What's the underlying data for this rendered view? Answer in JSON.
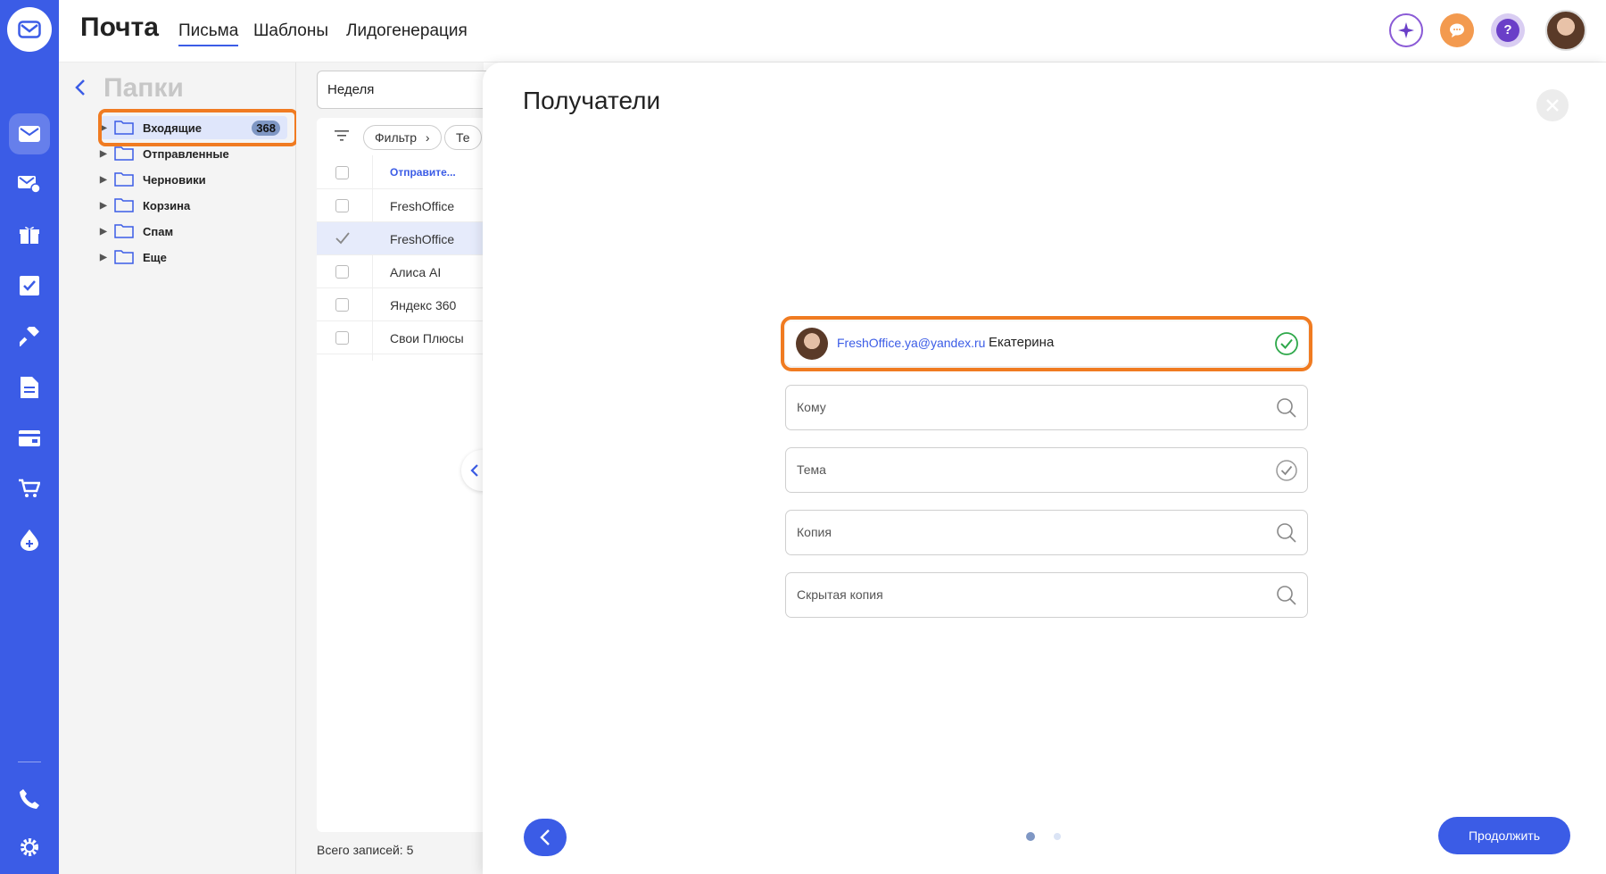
{
  "header": {
    "app_title": "Почта",
    "tabs": [
      {
        "label": "Письма",
        "active": true
      },
      {
        "label": "Шаблоны",
        "active": false
      },
      {
        "label": "Лидогенерация",
        "active": false
      }
    ],
    "icons": [
      "sparkle-icon",
      "chat-icon",
      "help-icon",
      "user-avatar"
    ],
    "help_glyph": "?"
  },
  "rail": {
    "accent": "#3b5ce6",
    "icons": [
      "mail-icon",
      "mail-send-icon",
      "gift-icon",
      "tasks-icon",
      "hammer-icon",
      "document-icon",
      "card-icon",
      "cart-icon",
      "drop-icon",
      "phone-icon",
      "gear-icon"
    ]
  },
  "folders": {
    "title": "Папки",
    "items": [
      {
        "label": "Входящие",
        "count": "368",
        "active": true
      },
      {
        "label": "Отправленные"
      },
      {
        "label": "Черновики"
      },
      {
        "label": "Корзина"
      },
      {
        "label": "Спам"
      },
      {
        "label": "Еще"
      }
    ]
  },
  "list": {
    "period": "Неделя",
    "filter_chip": "Фильтр",
    "second_chip": "Те",
    "sender_column": "Отправите...",
    "rows": [
      {
        "sender": "FreshOffice",
        "selected": false
      },
      {
        "sender": "FreshOffice",
        "selected": true
      },
      {
        "sender": "Алиса AI",
        "selected": false
      },
      {
        "sender": "Яндекс 360",
        "selected": false
      },
      {
        "sender": "Свои Плюсы",
        "selected": false
      }
    ],
    "total": "Всего записей: 5"
  },
  "modal": {
    "title": "Получатели",
    "sender": {
      "email": "FreshOffice.ya@yandex.ru",
      "name": "Екатерина"
    },
    "fields": [
      {
        "placeholder": "Кому",
        "icon": "search-icon"
      },
      {
        "placeholder": "Тема",
        "icon": "check-circle-icon"
      },
      {
        "placeholder": "Копия",
        "icon": "search-icon"
      },
      {
        "placeholder": "Скрытая копия",
        "icon": "search-icon"
      }
    ],
    "continue_label": "Продолжить",
    "pages": 2,
    "current_page": 1,
    "highlight_color": "#f07b21"
  }
}
